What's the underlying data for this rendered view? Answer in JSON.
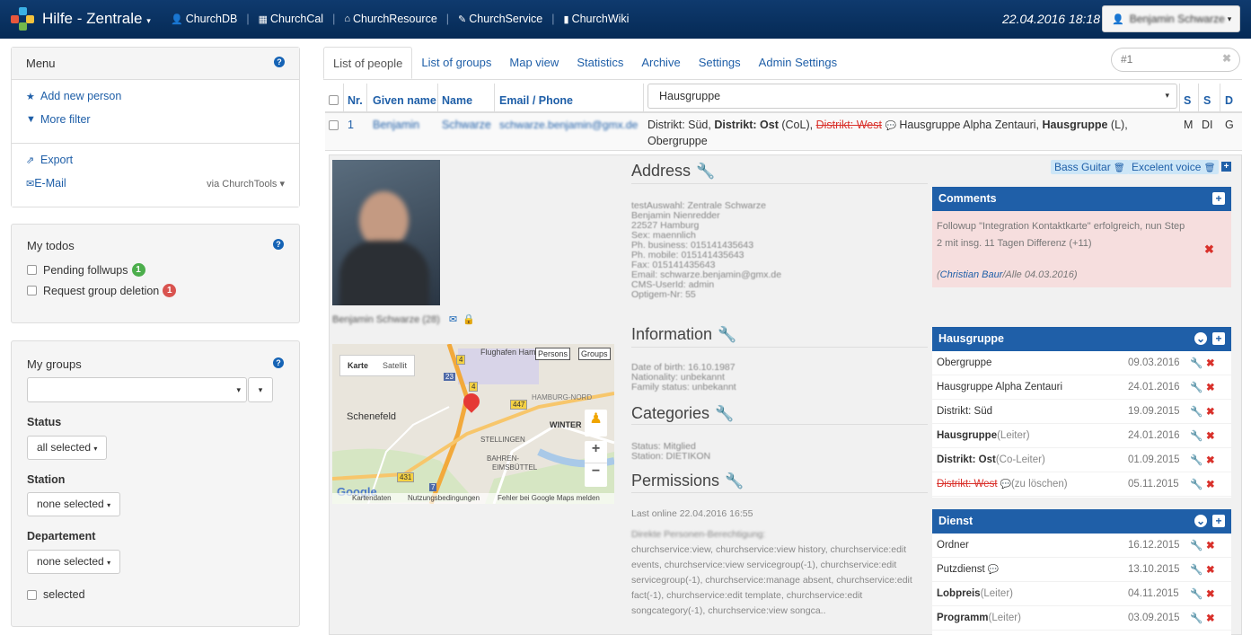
{
  "app": {
    "title": "Hilfe - Zentrale",
    "datetime": "22.04.2016 18:18",
    "user": "Benjamin Schwarze"
  },
  "nav": [
    {
      "label": "ChurchDB",
      "icon": "user-icon",
      "glyph": "👤"
    },
    {
      "label": "ChurchCal",
      "icon": "calendar-icon",
      "glyph": "▦"
    },
    {
      "label": "ChurchResource",
      "icon": "home-icon",
      "glyph": "⌂"
    },
    {
      "label": "ChurchService",
      "icon": "edit-icon",
      "glyph": "✎"
    },
    {
      "label": "ChurchWiki",
      "icon": "book-icon",
      "glyph": "▮"
    }
  ],
  "menu": {
    "title": "Menu",
    "add_person": "Add new person",
    "more_filter": "More filter",
    "export": "Export",
    "email": "E-Mail",
    "via": "via ChurchTools"
  },
  "todos": {
    "title": "My todos",
    "items": [
      {
        "label": "Pending follwups",
        "count": "1",
        "color": "#4cae4c"
      },
      {
        "label": "Request group deletion",
        "count": "1",
        "color": "#d9534f"
      }
    ]
  },
  "groups": {
    "title": "My groups",
    "status_label": "Status",
    "status_value": "all selected",
    "station_label": "Station",
    "station_value": "none selected",
    "departement_label": "Departement",
    "departement_value": "none selected",
    "selected_label": "selected"
  },
  "tabs": [
    "List of people",
    "List of groups",
    "Map view",
    "Statistics",
    "Archive",
    "Settings",
    "Admin Settings"
  ],
  "search": {
    "value": "#1"
  },
  "table": {
    "headers": {
      "nr": "Nr.",
      "given": "Given name",
      "name": "Name",
      "email": "Email / Phone",
      "group_select": "Hausgruppe",
      "s1": "S",
      "s2": "S",
      "d": "D"
    },
    "row": {
      "nr": "1",
      "given": "Benjamin",
      "name": "Schwarze",
      "email": "schwarze.benjamin@gmx.de",
      "groups_a": "Distrikt: Süd, ",
      "groups_b": "Distrikt: Ost",
      "groups_c": " (CoL), ",
      "groups_d": "Distrikt: West",
      "groups_e": " Hausgruppe Alpha Zentauri, ",
      "groups_f": "Hausgruppe",
      "groups_g": " (L), ",
      "groups_h": "Obergruppe",
      "s1": "M",
      "s2": "DI",
      "d": "G"
    }
  },
  "person": {
    "caption": "Benjamin Schwarze (28)"
  },
  "address": {
    "title": "Address",
    "lines": [
      "testAuswahl: Zentrale Schwarze",
      "Benjamin Nienredder",
      "22527 Hamburg",
      "Sex: maennlich",
      "Ph. business: 015141435643",
      "Ph. mobile: 015141435643",
      "Fax: 015141435643",
      "Email: schwarze.benjamin@gmx.de",
      "CMS-UserId: admin",
      "Optigem-Nr: 55"
    ]
  },
  "information": {
    "title": "Information",
    "lines": [
      "Date of birth: 16.10.1987",
      "Nationality: unbekannt",
      "Family status: unbekannt"
    ]
  },
  "categories": {
    "title": "Categories",
    "lines": [
      "Status: Mitglied",
      "Station: DIETIKON"
    ]
  },
  "permissions": {
    "title": "Permissions",
    "last_online": "Last online 22.04.2016 16:55",
    "subtitle": "Direkte Personen-Berechtigung:",
    "text": "churchservice:view, churchservice:view history, churchservice:edit events, churchservice:view servicegroup(-1), churchservice:edit servicegroup(-1), churchservice:manage absent, churchservice:edit fact(-1), churchservice:edit template, churchservice:edit songcategory(-1), churchservice:view songca.."
  },
  "skills": [
    "Bass Guitar",
    "Excelent voice"
  ],
  "map": {
    "tab_map": "Karte",
    "tab_sat": "Satellit",
    "persons": "Persons",
    "groups": "Groups",
    "city": "Schenefeld",
    "airport": "Flughafen Ham",
    "district1": "HAMBURG-NORD",
    "district2": "WINTER",
    "district3": "STELLINGEN",
    "district4": "BAHREN-",
    "district5": "EIMSBÜTTEL",
    "footer1": "Kartendaten",
    "footer2": "Nutzungsbedingungen",
    "footer3": "Fehler bei Google Maps melden",
    "google": "Google",
    "r1": "4",
    "r2": "23",
    "r3": "4",
    "r4": "447",
    "r5": "431",
    "r6": "7"
  },
  "comments": {
    "title": "Comments",
    "text": "Followup \"Integration Kontaktkarte\" erfolgreich, nun Step 2 mit insg. 11 Tagen Differenz (+11)",
    "author": "Christian Baur",
    "meta": "/Alle 04.03.2016)"
  },
  "hausgruppe": {
    "title": "Hausgruppe",
    "rows": [
      {
        "name": "Obergruppe",
        "role": "",
        "date": "09.03.2016",
        "bold": false,
        "strike": false
      },
      {
        "name": "Hausgruppe Alpha Zentauri",
        "role": "",
        "date": "24.01.2016",
        "bold": false,
        "strike": false
      },
      {
        "name": "Distrikt: Süd",
        "role": "",
        "date": "19.09.2015",
        "bold": false,
        "strike": false
      },
      {
        "name": "Hausgruppe",
        "role": " (Leiter)",
        "date": "24.01.2016",
        "bold": true,
        "strike": false
      },
      {
        "name": "Distrikt: Ost",
        "role": " (Co-Leiter)",
        "date": "01.09.2015",
        "bold": true,
        "strike": false
      },
      {
        "name": "Distrikt: West",
        "role": " (zu löschen)",
        "date": "05.11.2015",
        "bold": false,
        "strike": true
      }
    ]
  },
  "dienst": {
    "title": "Dienst",
    "rows": [
      {
        "name": "Ordner",
        "role": "",
        "date": "16.12.2015",
        "bold": false
      },
      {
        "name": "Putzdienst",
        "role": "",
        "date": "13.10.2015",
        "bold": false
      },
      {
        "name": "Lobpreis",
        "role": " (Leiter)",
        "date": "04.11.2015",
        "bold": true
      },
      {
        "name": "Programm",
        "role": " (Leiter)",
        "date": "03.09.2015",
        "bold": true
      }
    ]
  }
}
